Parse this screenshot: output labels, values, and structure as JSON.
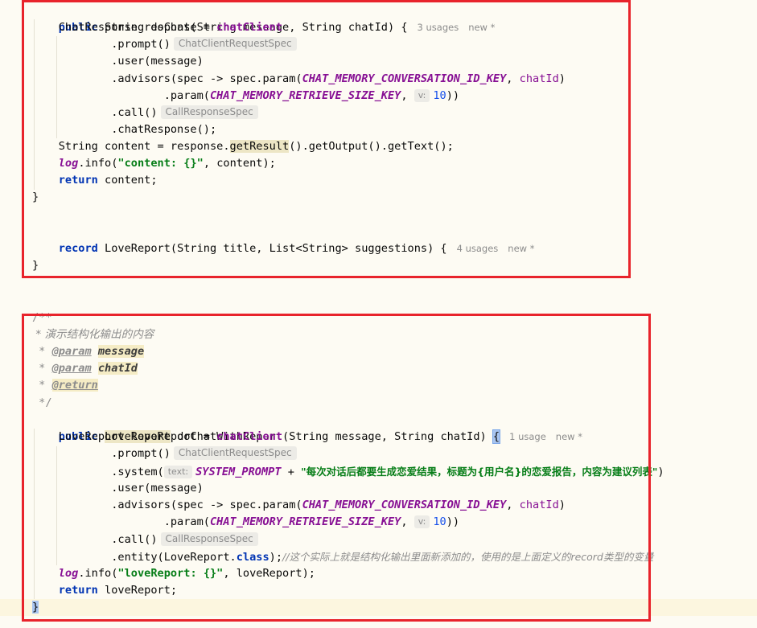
{
  "colors": {
    "keyword": "#0033b3",
    "field": "#871094",
    "string": "#067d17",
    "number": "#1750eb",
    "comment": "#8c8c8c",
    "annotation_box": "#e8232b",
    "background": "#fdfbf3"
  },
  "block1": {
    "sig_kw": "public",
    "sig_rest": " String doChat(String message, String chatId) {",
    "usages": "3 usages",
    "new_label": "new *",
    "l2_a": "ChatResponse response = ",
    "chat_client": "chatClient",
    "prompt": ".prompt()",
    "hint_request_spec": "ChatClientRequestSpec",
    "user": ".user(message)",
    "advisors_a": ".advisors(spec -> spec.param(",
    "const_conv_id": "CHAT_MEMORY_CONVERSATION_ID_KEY",
    "comma": ", ",
    "chat_id_param": "chatId",
    "close_paren": ")",
    "param_a": ".param(",
    "const_retrieve": "CHAT_MEMORY_RETRIEVE_SIZE_KEY",
    "comma2": ", ",
    "hint_v": "v:",
    "num_10": "10",
    "close2": "))",
    "call": ".call()",
    "hint_call_spec": "CallResponseSpec",
    "chat_response": ".chatResponse();",
    "content_a": "String content = response.",
    "get_result": "getResult",
    "content_b": "().getOutput().getText();",
    "log": "log",
    "info_a": ".info(",
    "log_str": "\"content: {}\"",
    "info_b": ", content);",
    "return_kw": "return",
    "return_rest": " content;",
    "close_brace": "}"
  },
  "record_line": {
    "kw": "record",
    "rest": " LoveReport(String title, List<String> suggestions) {",
    "usages": "4 usages",
    "new_label": "new *",
    "close": "}"
  },
  "block2": {
    "doc_open": "/**",
    "doc_desc": " * 演示结构化输出的内容",
    "doc_star": " * ",
    "doc_param_tag": "@param",
    "doc_param1": "message",
    "doc_param2": "chatId",
    "doc_return_tag": "@return",
    "doc_close": " */",
    "sig_kw": "public",
    "sig_type": "LoveReport",
    "sig_rest": " doChatWithReport(String message, String chatId) ",
    "sig_brace": "{",
    "usages": "1 usage",
    "new_label": "new *",
    "l2_a": "LoveReport loveReport = ",
    "chat_client": "chatClient",
    "prompt": ".prompt()",
    "hint_request_spec": "ChatClientRequestSpec",
    "system_a": ".system(",
    "hint_text": "text:",
    "system_prompt": "SYSTEM_PROMPT",
    "plus": " + ",
    "system_str": "\"每次对话后都要生成恋爱结果，标题为{用户名}的恋爱报告，内容为建议列表\"",
    "system_close": ")",
    "user": ".user(message)",
    "advisors_a": ".advisors(spec -> spec.param(",
    "const_conv_id": "CHAT_MEMORY_CONVERSATION_ID_KEY",
    "comma": ", ",
    "chat_id_param": "chatId",
    "close_paren": ")",
    "param_a": ".param(",
    "const_retrieve": "CHAT_MEMORY_RETRIEVE_SIZE_KEY",
    "comma2": ", ",
    "hint_v": "v:",
    "num_10": "10",
    "close2": "))",
    "call": ".call()",
    "hint_call_spec": "CallResponseSpec",
    "entity_a": ".entity(LoveReport.",
    "class_kw": "class",
    "entity_b": ");",
    "entity_comment": "//这个实际上就是结构化输出里面新添加的，使用的是上面定义的record类型的变量",
    "log": "log",
    "info_a": ".info(",
    "log_str": "\"loveReport: {}\"",
    "info_b": ", loveReport);",
    "return_kw": "return",
    "return_rest": " loveReport;",
    "close_brace": "}"
  }
}
